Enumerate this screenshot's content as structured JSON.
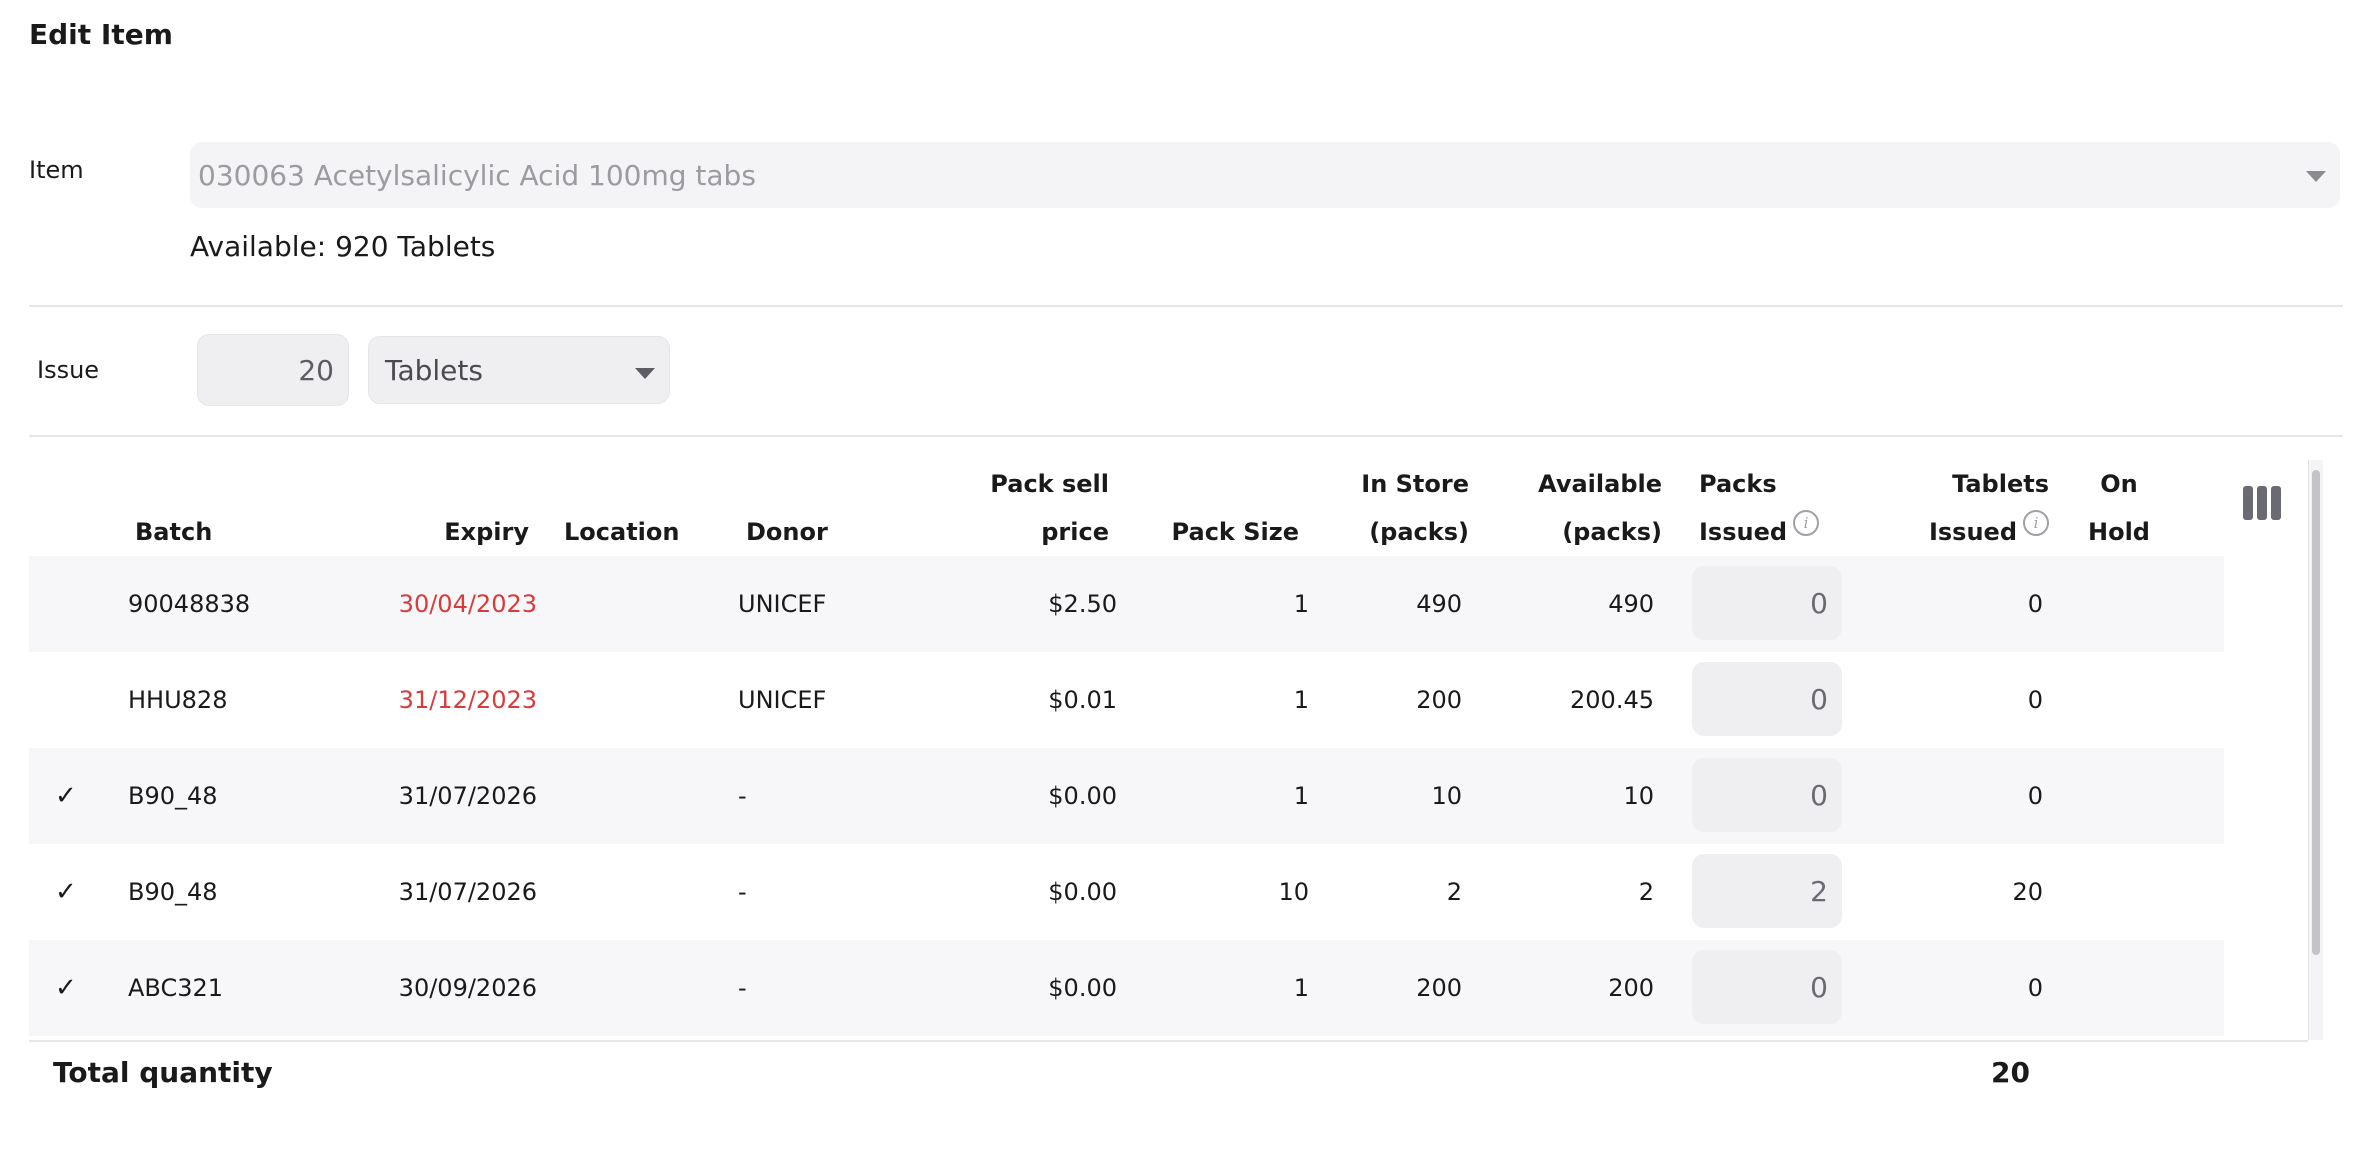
{
  "dialog": {
    "title": "Edit Item"
  },
  "item": {
    "label": "Item",
    "value": "030063 Acetylsalicylic Acid 100mg tabs",
    "available": "Available: 920 Tablets"
  },
  "issue": {
    "label": "Issue",
    "quantity": "20",
    "unit": "Tablets"
  },
  "table": {
    "headers": {
      "batch": "Batch",
      "expiry": "Expiry",
      "location": "Location",
      "donor": "Donor",
      "pack_sell_price": [
        "Pack sell",
        "price"
      ],
      "pack_size": "Pack Size",
      "in_store": [
        "In Store",
        "(packs)"
      ],
      "available": [
        "Available",
        "(packs)"
      ],
      "packs_issued": [
        "Packs",
        "Issued"
      ],
      "tablets_issued": [
        "Tablets",
        "Issued"
      ],
      "on_hold": [
        "On",
        "Hold"
      ]
    },
    "rows": [
      {
        "check": "",
        "batch": "90048838",
        "expiry": "30/04/2023",
        "expired": true,
        "location": "",
        "donor": "UNICEF",
        "price": "$2.50",
        "pack_size": "1",
        "in_store": "490",
        "available": "490",
        "packs_issued": "0",
        "tablets_issued": "0"
      },
      {
        "check": "",
        "batch": "HHU828",
        "expiry": "31/12/2023",
        "expired": true,
        "location": "",
        "donor": "UNICEF",
        "price": "$0.01",
        "pack_size": "1",
        "in_store": "200",
        "available": "200.45",
        "packs_issued": "0",
        "tablets_issued": "0"
      },
      {
        "check": "✓",
        "batch": "B90_48",
        "expiry": "31/07/2026",
        "expired": false,
        "location": "",
        "donor": "-",
        "price": "$0.00",
        "pack_size": "1",
        "in_store": "10",
        "available": "10",
        "packs_issued": "0",
        "tablets_issued": "0"
      },
      {
        "check": "✓",
        "batch": "B90_48",
        "expiry": "31/07/2026",
        "expired": false,
        "location": "",
        "donor": "-",
        "price": "$0.00",
        "pack_size": "10",
        "in_store": "2",
        "available": "2",
        "packs_issued": "2",
        "tablets_issued": "20"
      },
      {
        "check": "✓",
        "batch": "ABC321",
        "expiry": "30/09/2026",
        "expired": false,
        "location": "",
        "donor": "-",
        "price": "$0.00",
        "pack_size": "1",
        "in_store": "200",
        "available": "200",
        "packs_issued": "0",
        "tablets_issued": "0"
      }
    ],
    "total_label": "Total quantity",
    "total_value": "20"
  },
  "icons": {
    "info": "info-icon",
    "columns": "columns-icon",
    "dropdown": "chevron-down-icon",
    "check": "check-icon"
  },
  "colors": {
    "expired_text": "#d93a3a",
    "row_shade": "#f7f7f9",
    "input_bg": "#efeff2"
  }
}
